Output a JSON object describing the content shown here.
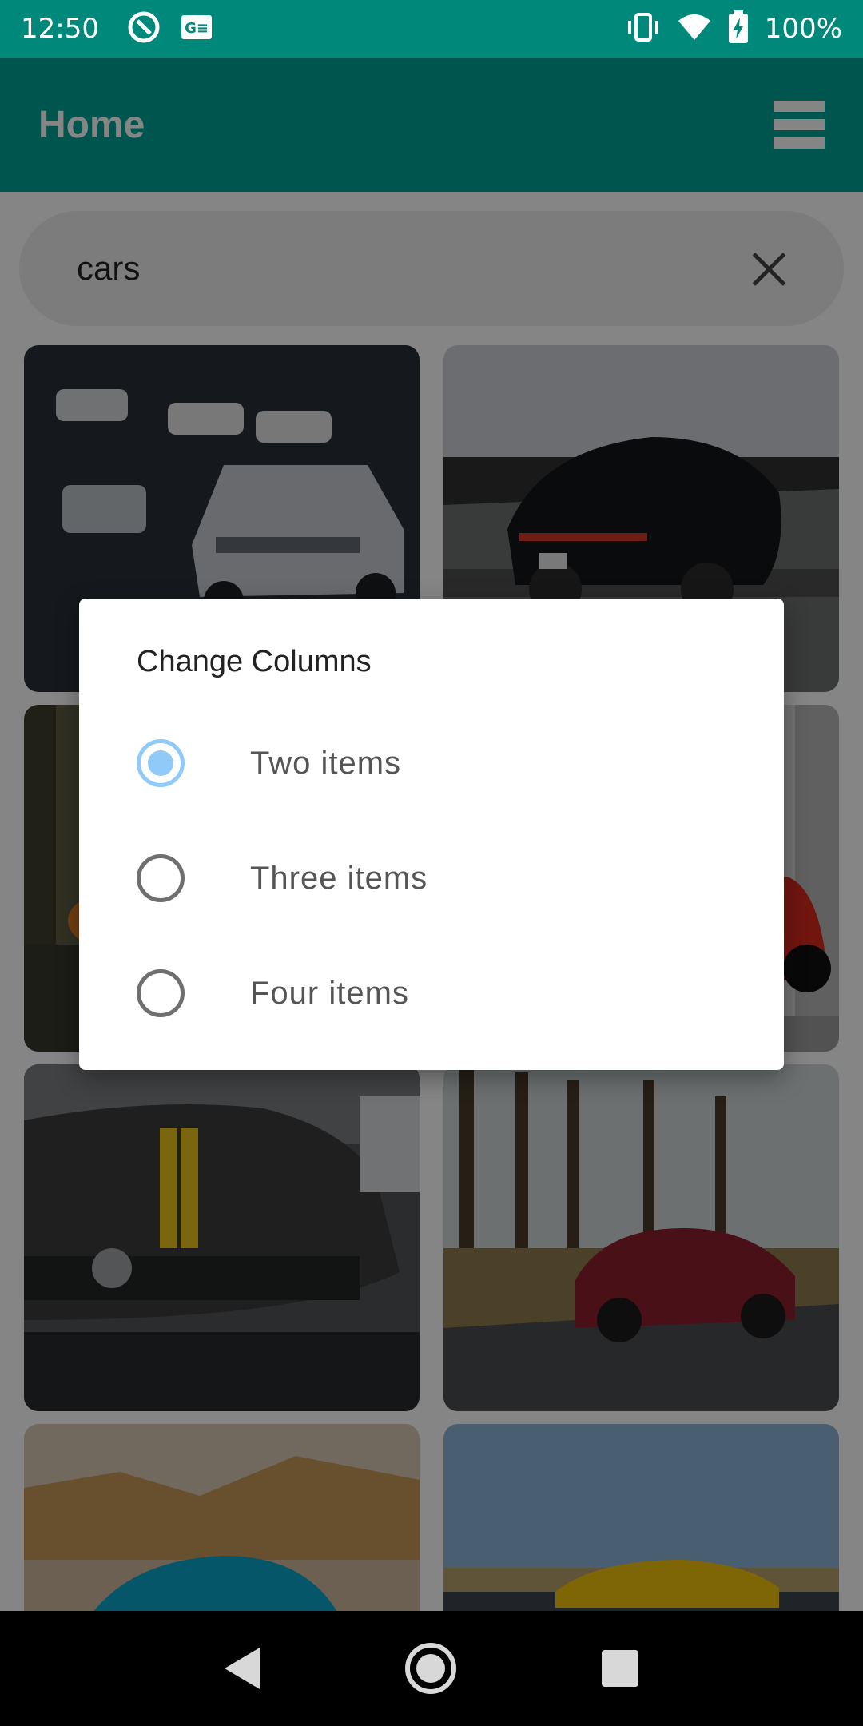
{
  "status_bar": {
    "time": "12:50",
    "battery_text": "100%",
    "icons": [
      "sync-icon",
      "gmail-icon",
      "vibrate-icon",
      "wifi-icon",
      "battery-charging-icon"
    ]
  },
  "app_bar": {
    "title": "Home",
    "menu_icon": "hamburger-menu-icon"
  },
  "search": {
    "value": "cars",
    "clear_icon": "close-icon"
  },
  "gallery": {
    "images": [
      {
        "alt": "gray sports car in garage"
      },
      {
        "alt": "black porsche on road"
      },
      {
        "alt": "orange car in forest"
      },
      {
        "alt": "red car in garage"
      },
      {
        "alt": "gray mercedes with yellow stripe"
      },
      {
        "alt": "red mercedes amg in forest"
      },
      {
        "alt": "blue sports car in desert"
      },
      {
        "alt": "yellow sports car"
      }
    ]
  },
  "dialog": {
    "title": "Change Columns",
    "options": [
      {
        "label": "Two items",
        "selected": true
      },
      {
        "label": "Three items",
        "selected": false
      },
      {
        "label": "Four items",
        "selected": false
      }
    ]
  },
  "nav_bar": {
    "icons": [
      "back-icon",
      "home-icon",
      "recents-icon"
    ]
  },
  "colors": {
    "status_bar": "#00897b",
    "app_bar": "#00a596",
    "radio_selected": "#90caf9",
    "radio_unselected": "#6f6f6f"
  }
}
